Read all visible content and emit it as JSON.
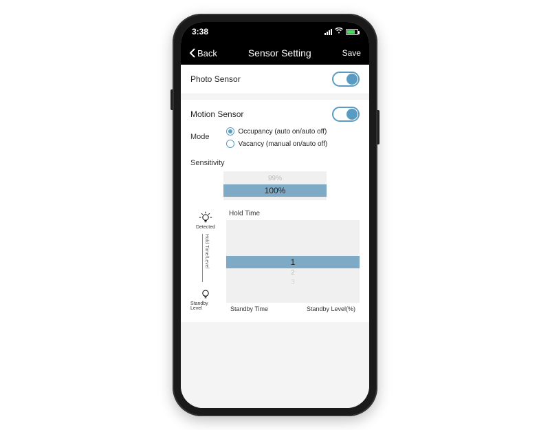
{
  "status": {
    "time": "3:38"
  },
  "nav": {
    "back": "Back",
    "title": "Sensor Setting",
    "save": "Save"
  },
  "photo": {
    "label": "Photo Sensor",
    "on": true
  },
  "motion": {
    "label": "Motion Sensor",
    "on": true,
    "mode_label": "Mode",
    "modes": [
      {
        "label": "Occupancy (auto on/auto off)",
        "selected": true
      },
      {
        "label": "Vacancy (manual on/auto off)",
        "selected": false
      }
    ],
    "sensitivity": {
      "label": "Sensitivity",
      "prev": "99%",
      "value": "100%"
    },
    "hold": {
      "label": "Hold Time",
      "detected_label": "Detected",
      "axis_label": "Hold Time/Level",
      "standby_label": "Standby Level",
      "value": "1",
      "next1": "2",
      "next2": "3",
      "standby_time": "Standby Time",
      "standby_level": "Standby Level(%)"
    }
  }
}
